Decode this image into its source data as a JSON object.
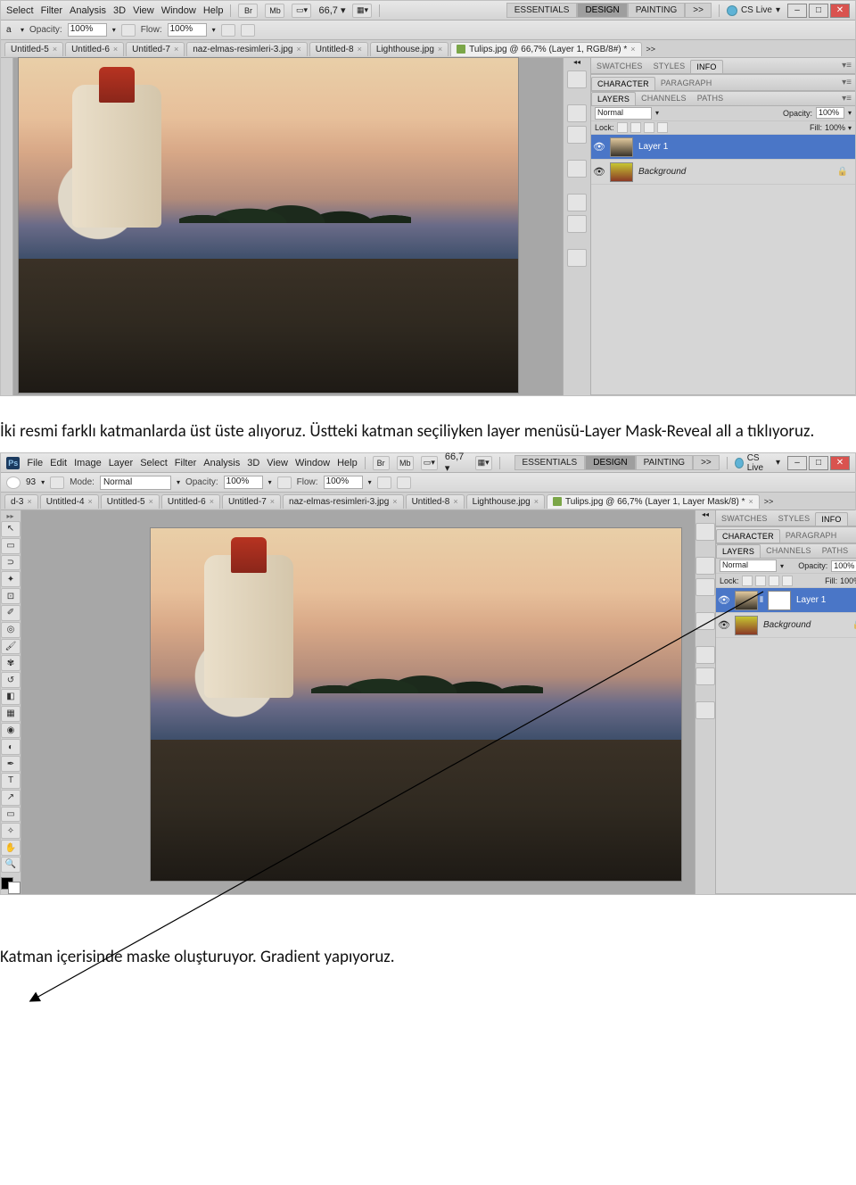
{
  "captions": {
    "a": "İki resmi farklı katmanlarda üst üste alıyoruz. Üstteki katman seçiliyken layer menüsü-Layer Mask-Reveal all a tıklıyoruz.",
    "b": "Katman içerisinde maske oluşturuyor. Gradient yapıyoruz."
  },
  "menus": {
    "file": "File",
    "edit": "Edit",
    "image": "Image",
    "layer": "Layer",
    "select": "Select",
    "filter": "Filter",
    "analysis": "Analysis",
    "threeD": "3D",
    "view": "View",
    "window": "Window",
    "help": "Help",
    "br": "Br",
    "mb": "Mb",
    "zoom": "66,7",
    "dd": "▾"
  },
  "workspace": {
    "essentials": "ESSENTIALS",
    "design": "DESIGN",
    "painting": "PAINTING",
    "dd": ">>",
    "cslive": "CS Live"
  },
  "optbar": {
    "brush_sel": "93",
    "mode_lbl": "Mode:",
    "mode_val": "Normal",
    "opacity_lbl": "Opacity:",
    "opacity_val": "100%",
    "flow_lbl": "Flow:",
    "flow_val": "100%"
  },
  "tabs_a": {
    "t1": "Untitled-5",
    "t2": "Untitled-6",
    "t3": "Untitled-7",
    "t4": "naz-elmas-resimleri-3.jpg",
    "t5": "Untitled-8",
    "t6": "Lighthouse.jpg",
    "t7": "Tulips.jpg @ 66,7% (Layer 1, RGB/8#) *",
    "dd": ">>"
  },
  "panel_top_a": {
    "swatches": "SWATCHES",
    "styles": "STYLES",
    "info": "INFO"
  },
  "panel_char": {
    "character": "CHARACTER",
    "paragraph": "PARAGRAPH"
  },
  "panel_layers": {
    "layers": "LAYERS",
    "channels": "CHANNELS",
    "paths": "PATHS",
    "mode": "Normal",
    "opacity_lbl": "Opacity:",
    "opacity_val": "100%",
    "lock_lbl": "Lock:",
    "fill_lbl": "Fill:",
    "fill_val": "100%",
    "layer1": "Layer 1",
    "background": "Background"
  },
  "tabs_b": {
    "t0": "d-3",
    "t1": "Untitled-4",
    "t2": "Untitled-5",
    "t3": "Untitled-6",
    "t4": "Untitled-7",
    "t5": "naz-elmas-resimleri-3.jpg",
    "t6": "Untitled-8",
    "t7": "Lighthouse.jpg",
    "t8": "Tulips.jpg @ 66,7% (Layer 1, Layer Mask/8) *",
    "dd": ">>"
  },
  "ps_logo": "Ps"
}
